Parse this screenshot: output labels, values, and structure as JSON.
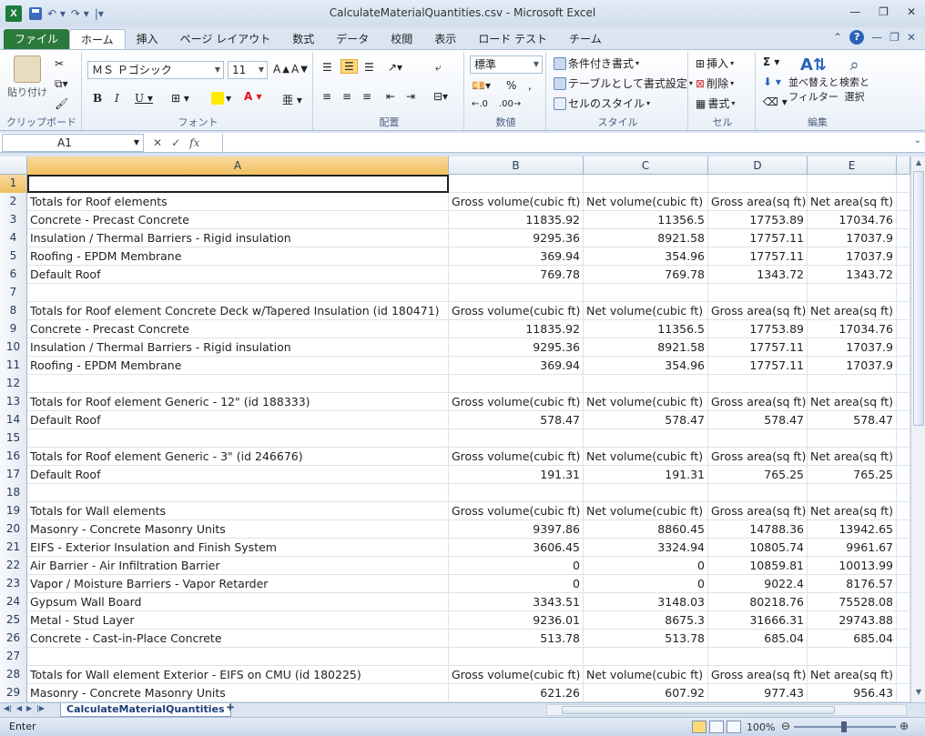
{
  "window": {
    "title": "CalculateMaterialQuantities.csv - Microsoft Excel",
    "app_icon": "X"
  },
  "tabs": [
    "ファイル",
    "ホーム",
    "挿入",
    "ページ レイアウト",
    "数式",
    "データ",
    "校閲",
    "表示",
    "ロード テスト",
    "チーム"
  ],
  "ribbon": {
    "clipboard": {
      "label": "クリップボード",
      "paste": "貼り付け"
    },
    "font": {
      "label": "フォント",
      "font_name": "ＭＳ Ｐゴシック",
      "font_size": "11"
    },
    "alignment": {
      "label": "配置"
    },
    "number": {
      "label": "数値",
      "format": "標準"
    },
    "styles": {
      "label": "スタイル",
      "conditional": "条件付き書式",
      "table": "テーブルとして書式設定",
      "cell_styles": "セルのスタイル"
    },
    "cells": {
      "label": "セル",
      "insert": "挿入",
      "delete": "削除",
      "format": "書式"
    },
    "editing": {
      "label": "編集",
      "sort": "並べ替えと",
      "filter": "フィルター",
      "find": "検索と",
      "select": "選択"
    }
  },
  "formula_bar": {
    "name_box": "A1",
    "formula": ""
  },
  "columns": [
    {
      "name": "A",
      "width": 463
    },
    {
      "name": "B",
      "width": 148
    },
    {
      "name": "C",
      "width": 137
    },
    {
      "name": "D",
      "width": 109
    },
    {
      "name": "E",
      "width": 98
    },
    {
      "name": "",
      "width": 15
    }
  ],
  "rows": [
    [
      "",
      "",
      "",
      "",
      ""
    ],
    [
      "Totals for Roof elements",
      "Gross volume(cubic ft)",
      "Net volume(cubic ft)",
      "Gross area(sq ft)",
      "Net area(sq ft)"
    ],
    [
      "Concrete - Precast Concrete",
      "11835.92",
      "11356.5",
      "17753.89",
      "17034.76"
    ],
    [
      "Insulation / Thermal Barriers - Rigid insulation",
      "9295.36",
      "8921.58",
      "17757.11",
      "17037.9"
    ],
    [
      "Roofing - EPDM Membrane",
      "369.94",
      "354.96",
      "17757.11",
      "17037.9"
    ],
    [
      "Default Roof",
      "769.78",
      "769.78",
      "1343.72",
      "1343.72"
    ],
    [
      "",
      "",
      "",
      "",
      ""
    ],
    [
      "Totals for Roof element Concrete Deck w/Tapered Insulation (id 180471)",
      "Gross volume(cubic ft)",
      "Net volume(cubic ft)",
      "Gross area(sq ft)",
      "Net area(sq ft)"
    ],
    [
      "Concrete - Precast Concrete",
      "11835.92",
      "11356.5",
      "17753.89",
      "17034.76"
    ],
    [
      "Insulation / Thermal Barriers - Rigid insulation",
      "9295.36",
      "8921.58",
      "17757.11",
      "17037.9"
    ],
    [
      "Roofing - EPDM Membrane",
      "369.94",
      "354.96",
      "17757.11",
      "17037.9"
    ],
    [
      "",
      "",
      "",
      "",
      ""
    ],
    [
      "Totals for Roof element Generic - 12\" (id 188333)",
      "Gross volume(cubic ft)",
      "Net volume(cubic ft)",
      "Gross area(sq ft)",
      "Net area(sq ft)"
    ],
    [
      "Default Roof",
      "578.47",
      "578.47",
      "578.47",
      "578.47"
    ],
    [
      "",
      "",
      "",
      "",
      ""
    ],
    [
      "Totals for Roof element Generic - 3\" (id 246676)",
      "Gross volume(cubic ft)",
      "Net volume(cubic ft)",
      "Gross area(sq ft)",
      "Net area(sq ft)"
    ],
    [
      "Default Roof",
      "191.31",
      "191.31",
      "765.25",
      "765.25"
    ],
    [
      "",
      "",
      "",
      "",
      ""
    ],
    [
      "Totals for Wall elements",
      "Gross volume(cubic ft)",
      "Net volume(cubic ft)",
      "Gross area(sq ft)",
      "Net area(sq ft)"
    ],
    [
      "Masonry - Concrete Masonry Units",
      "9397.86",
      "8860.45",
      "14788.36",
      "13942.65"
    ],
    [
      "EIFS - Exterior Insulation and Finish System",
      "3606.45",
      "3324.94",
      "10805.74",
      "9961.67"
    ],
    [
      "Air Barrier - Air Infiltration Barrier",
      "0",
      "0",
      "10859.81",
      "10013.99"
    ],
    [
      "Vapor / Moisture Barriers - Vapor Retarder",
      "0",
      "0",
      "9022.4",
      "8176.57"
    ],
    [
      "Gypsum Wall Board",
      "3343.51",
      "3148.03",
      "80218.76",
      "75528.08"
    ],
    [
      "Metal - Stud Layer",
      "9236.01",
      "8675.3",
      "31666.31",
      "29743.88"
    ],
    [
      "Concrete - Cast-in-Place Concrete",
      "513.78",
      "513.78",
      "685.04",
      "685.04"
    ],
    [
      "",
      "",
      "",
      "",
      ""
    ],
    [
      "Totals for Wall element Exterior - EIFS on CMU (id 180225)",
      "Gross volume(cubic ft)",
      "Net volume(cubic ft)",
      "Gross area(sq ft)",
      "Net area(sq ft)"
    ],
    [
      "Masonry - Concrete Masonry Units",
      "621.26",
      "607.92",
      "977.43",
      "956.43"
    ]
  ],
  "sheet_tab": "CalculateMaterialQuantities",
  "status": {
    "mode": "Enter",
    "zoom": "100%"
  }
}
